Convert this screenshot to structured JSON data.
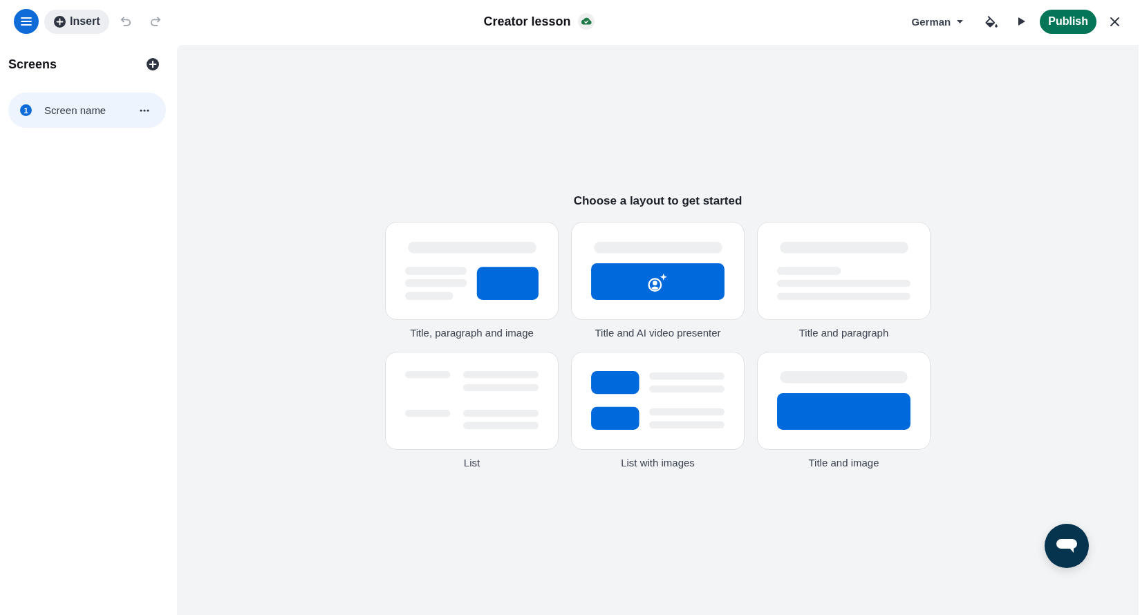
{
  "header": {
    "insert_button": "Insert",
    "history": [
      {
        "kind": "undo",
        "disabled": true
      },
      {
        "kind": "redo",
        "disabled": true
      }
    ],
    "title": "Creator lesson",
    "language": "German",
    "publish_button": "Publish"
  },
  "sidebar": {
    "heading": "Screens",
    "screens": [
      {
        "number": "1",
        "name": "Screen name",
        "selected": true
      }
    ]
  },
  "main": {
    "heading": "Choose a layout to get started",
    "layouts": [
      {
        "kind": "split",
        "label": "Title, paragraph and image"
      },
      {
        "kind": "presenter",
        "label": "Title and AI video presenter"
      },
      {
        "kind": "text",
        "label": "Title and paragraph"
      },
      {
        "kind": "list",
        "label": "List"
      },
      {
        "kind": "medialist",
        "label": "List with images"
      },
      {
        "kind": "banner",
        "label": "Title and image"
      }
    ]
  }
}
